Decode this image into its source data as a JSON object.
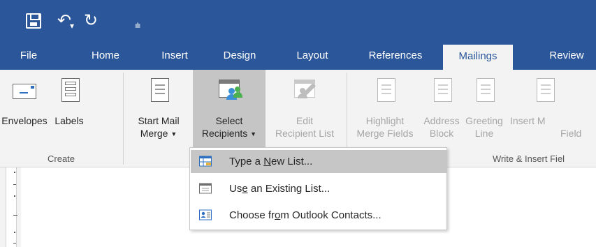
{
  "quick_access": {
    "save_icon": "save-icon",
    "undo_icon": "undo-icon",
    "redo_icon": "redo-icon",
    "customize_icon": "customize-quick-access-icon"
  },
  "tabs": [
    {
      "label": "File"
    },
    {
      "label": "Home"
    },
    {
      "label": "Insert"
    },
    {
      "label": "Design"
    },
    {
      "label": "Layout"
    },
    {
      "label": "References"
    },
    {
      "label": "Mailings",
      "active": true
    },
    {
      "label": "Review"
    }
  ],
  "ribbon": {
    "envelopes": "Envelopes",
    "labels": "Labels",
    "start_mail_merge_1": "Start Mail",
    "start_mail_merge_2": "Merge",
    "select_recipients_1": "Select",
    "select_recipients_2": "Recipients",
    "edit_recipient_list_1": "Edit",
    "edit_recipient_list_2": "Recipient List",
    "highlight_1": "Highlight",
    "highlight_2": "Merge Fields",
    "address_1": "Address",
    "address_2": "Block",
    "greeting_1": "Greeting",
    "greeting_2": "Line",
    "insert_1": "Insert M",
    "insert_2": "Field",
    "group_create": "Create",
    "group_write_insert": "Write & Insert Fiel"
  },
  "dropdown": {
    "items": [
      {
        "pre": "Type a ",
        "ul": "N",
        "post": "ew List..."
      },
      {
        "pre": "Us",
        "ul": "e",
        "post": " an Existing List..."
      },
      {
        "pre": "Choose fr",
        "ul": "o",
        "post": "m Outlook Contacts..."
      }
    ]
  },
  "colors": {
    "title_bar": "#2b579a",
    "ribbon_bg": "#f3f3f3",
    "pressed_button": "#c5c5c5",
    "menu_highlight": "#c6c6c6"
  }
}
